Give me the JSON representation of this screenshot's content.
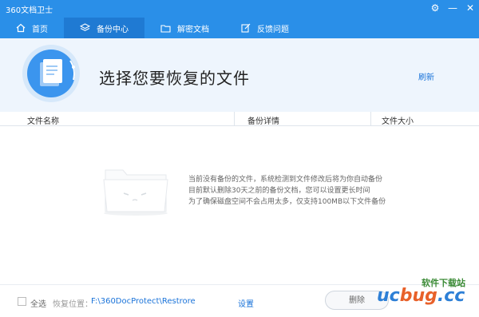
{
  "titlebar": {
    "title": "360文档卫士"
  },
  "nav": {
    "items": [
      {
        "label": "首页",
        "icon": "home-icon"
      },
      {
        "label": "备份中心",
        "icon": "layers-icon"
      },
      {
        "label": "解密文档",
        "icon": "folder-icon"
      },
      {
        "label": "反馈问题",
        "icon": "edit-icon"
      }
    ],
    "active_index": 1
  },
  "header": {
    "title": "选择您要恢复的文件",
    "refresh_label": "刷新"
  },
  "table": {
    "columns": [
      "文件名称",
      "备份详情",
      "文件大小"
    ]
  },
  "empty_state": {
    "lines": [
      "当前没有备份的文件，系统检测到文件修改后将为你自动备份",
      "目前默认删除30天之前的备份文档，您可以设置更长时间",
      "为了确保磁盘空间不会占用太多，仅支持100MB以下文件备份"
    ]
  },
  "footer": {
    "select_all_label": "全选",
    "location_label": "恢复位置：",
    "location_path": "F:\\360DocProtect\\Restrore",
    "settings_label": "设置",
    "delete_label": "删除"
  },
  "watermark": {
    "text_cn": "软件下载站",
    "text_latin_1": "uc",
    "text_latin_2": "bug",
    "text_latin_3": ".cc"
  },
  "colors": {
    "accent": "#2a8fe8",
    "accent_dark": "#1f7ad3",
    "link": "#1a73d9",
    "header_bg": "#eef5fd"
  }
}
